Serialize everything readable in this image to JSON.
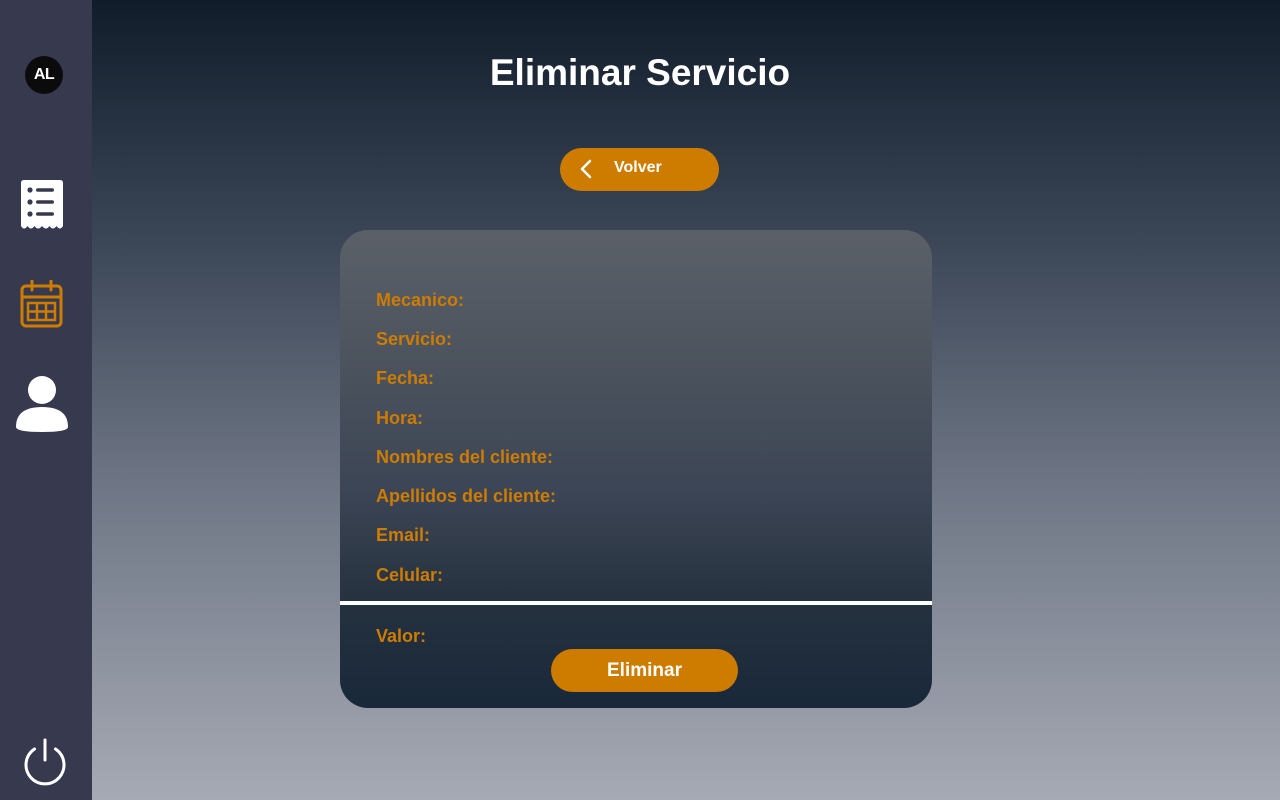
{
  "sidebar": {
    "logo_text": "AL",
    "items": [
      {
        "icon": "receipt-list-icon",
        "color": "#ffffff"
      },
      {
        "icon": "calendar-icon",
        "color": "#cd7c00"
      },
      {
        "icon": "user-icon",
        "color": "#ffffff"
      }
    ],
    "power_icon": "power-icon"
  },
  "page": {
    "title": "Eliminar Servicio"
  },
  "back_button": {
    "label": "Volver",
    "icon": "chevron-left-icon"
  },
  "form": {
    "fields": [
      {
        "label": "Mecanico:"
      },
      {
        "label": "Servicio:"
      },
      {
        "label": "Fecha:"
      },
      {
        "label": "Hora:"
      },
      {
        "label": "Nombres del cliente:"
      },
      {
        "label": "Apellidos del cliente:"
      },
      {
        "label": "Email:"
      },
      {
        "label": "Celular:"
      }
    ],
    "valor_label": "Valor:",
    "delete_label": "Eliminar"
  },
  "colors": {
    "accent": "#cd7c00",
    "sidebar": "#373a4e"
  }
}
